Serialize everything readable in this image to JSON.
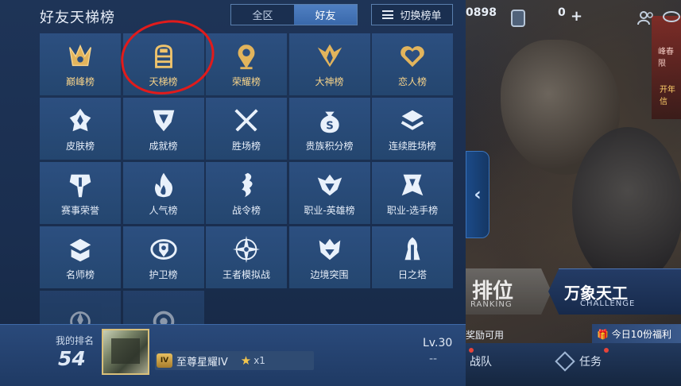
{
  "panel": {
    "title": "好友天梯榜",
    "tabs": [
      {
        "label": "全区",
        "active": false
      },
      {
        "label": "好友",
        "active": true
      }
    ],
    "switch_label": "切换榜单"
  },
  "boards": [
    {
      "label": "巅峰榜",
      "icon": "peak-crown-icon",
      "gold": true
    },
    {
      "label": "天梯榜",
      "icon": "ladder-icon",
      "gold": true
    },
    {
      "label": "荣耀榜",
      "icon": "glory-pin-icon",
      "gold": true
    },
    {
      "label": "大神榜",
      "icon": "wings-emblem-icon",
      "gold": true
    },
    {
      "label": "恋人榜",
      "icon": "heart-icon",
      "gold": true
    },
    {
      "label": "皮肤榜",
      "icon": "skin-icon",
      "gold": false
    },
    {
      "label": "成就榜",
      "icon": "achievement-icon",
      "gold": false
    },
    {
      "label": "胜场榜",
      "icon": "crossed-swords-icon",
      "gold": false
    },
    {
      "label": "贵族积分榜",
      "icon": "money-bag-icon",
      "gold": false
    },
    {
      "label": "连续胜场榜",
      "icon": "chevron-stack-icon",
      "gold": false
    },
    {
      "label": "赛事荣誉",
      "icon": "tournament-icon",
      "gold": false
    },
    {
      "label": "人气榜",
      "icon": "flame-icon",
      "gold": false
    },
    {
      "label": "战令榜",
      "icon": "battle-pass-icon",
      "gold": false
    },
    {
      "label": "职业-英雄榜",
      "icon": "pro-hero-icon",
      "gold": false
    },
    {
      "label": "职业-选手榜",
      "icon": "pro-player-icon",
      "gold": false
    },
    {
      "label": "名师榜",
      "icon": "mentor-book-icon",
      "gold": false
    },
    {
      "label": "护卫榜",
      "icon": "guard-shield-icon",
      "gold": false
    },
    {
      "label": "王者模拟战",
      "icon": "compass-star-icon",
      "gold": false
    },
    {
      "label": "边境突围",
      "icon": "border-breakout-icon",
      "gold": false
    },
    {
      "label": "日之塔",
      "icon": "sun-tower-icon",
      "gold": false
    },
    {
      "label": "",
      "icon": "partial-emblem-icon",
      "gold": false
    },
    {
      "label": "",
      "icon": "ring-target-icon",
      "gold": false
    }
  ],
  "my_rank": {
    "label": "我的排名",
    "value": "54",
    "tier_badge": "IV",
    "tier_name": "至尊星耀IV",
    "stars": "x1",
    "level": "Lv.30",
    "level_sub": "--"
  },
  "background": {
    "hud_value_1": "0898",
    "hud_value_2": "0",
    "mode_rank": "排位",
    "mode_rank_sub": "RANKING",
    "mode_challenge": "万象天工",
    "mode_challenge_sub": "CHALLENGE",
    "reward_text": "奖励可用",
    "daily_text": "今日10份福利",
    "team_label": "战队",
    "task_label": "任务",
    "corner_text_1": "峰春限",
    "corner_text_2": "开年信"
  },
  "colors": {
    "panel_bg": "#1e3457",
    "cell_bg": "#2c4f80",
    "gold_text": "#f7d38a",
    "annotation_circle": "#e11b1b"
  }
}
